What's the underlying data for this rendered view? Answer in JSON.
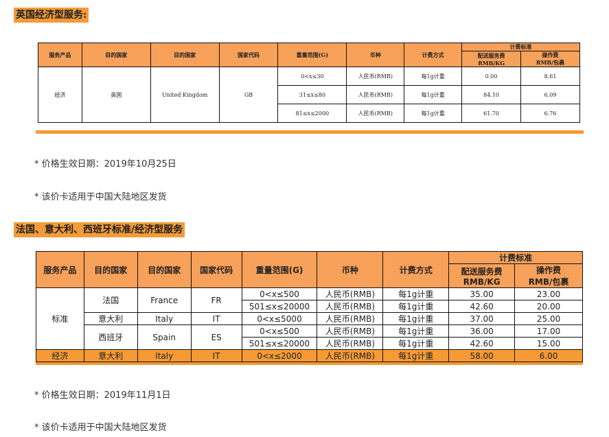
{
  "section1": {
    "heading": "英国经济型服务:",
    "headers": {
      "product": "服务产品",
      "dest_cn": "目的国家",
      "dest_en": "目的国家",
      "code": "国家代码",
      "weight": "重量范围(G)",
      "currency": "币种",
      "billing": "计费方式",
      "standard": "计费标准",
      "delivery_fee": "配送服务费",
      "delivery_unit": "RMB/KG",
      "handling_fee": "操作费",
      "handling_unit": "RMB/包裹"
    },
    "product": "经济",
    "dest_cn": "英国",
    "dest_en": "United Kingdom",
    "code": "GB",
    "rows": [
      {
        "weight": "0<x≤30",
        "currency": "人民币(RMB)",
        "billing": "每1g计重",
        "delivery": "0.00",
        "handling": "8.61"
      },
      {
        "weight": "31≤x≤80",
        "currency": "人民币(RMB)",
        "billing": "每1g计重",
        "delivery": "84.10",
        "handling": "6.09"
      },
      {
        "weight": "81≤x≤2000",
        "currency": "人民币(RMB)",
        "billing": "每1g计重",
        "delivery": "61.70",
        "handling": "6.76"
      }
    ],
    "note1": "* 价格生效日期：2019年10月25日",
    "note2": "* 该价卡适用于中国大陆地区发货"
  },
  "section2": {
    "heading": "法国、意大利、西班牙标准/经济型服务",
    "headers": {
      "product": "服务产品",
      "dest_cn": "目的国家",
      "dest_en": "目的国家",
      "code": "国家代码",
      "weight": "重量范围(G)",
      "currency": "币种",
      "billing": "计费方式",
      "standard": "计费标准",
      "delivery_fee": "配送服务费",
      "delivery_unit": "RMB/KG",
      "handling_fee": "操作费",
      "handling_unit": "RMB/包裹"
    },
    "standard_product": "标准",
    "france": {
      "cn": "法国",
      "en": "France",
      "code": "FR"
    },
    "italy": {
      "cn": "意大利",
      "en": "Italy",
      "code": "IT"
    },
    "spain": {
      "cn": "西班牙",
      "en": "Spain",
      "code": "ES"
    },
    "rows": {
      "fr1": {
        "weight": "0<x≤500",
        "currency": "人民币(RMB)",
        "billing": "每1g计重",
        "delivery": "35.00",
        "handling": "23.00"
      },
      "fr2": {
        "weight": "501≤x≤20000",
        "currency": "人民币(RMB)",
        "billing": "每1g计重",
        "delivery": "42.60",
        "handling": "20.00"
      },
      "it1": {
        "weight": "0<x≤5000",
        "currency": "人民币(RMB)",
        "billing": "每1g计重",
        "delivery": "37.00",
        "handling": "25.00"
      },
      "es1": {
        "weight": "0<x≤500",
        "currency": "人民币(RMB)",
        "billing": "每1g计重",
        "delivery": "36.00",
        "handling": "17.00"
      },
      "es2": {
        "weight": "501≤x≤20000",
        "currency": "人民币(RMB)",
        "billing": "每1g计重",
        "delivery": "42.60",
        "handling": "15.00"
      }
    },
    "economy": {
      "product": "经济",
      "cn": "意大利",
      "en": "Italy",
      "code": "IT",
      "weight": "0<x≤2000",
      "currency": "人民币(RMB)",
      "billing": "每1g计重",
      "delivery": "58.00",
      "handling": "6.00"
    },
    "note1": "* 价格生效日期：2019年11月1日",
    "note2": "* 该价卡适用于中国大陆地区发货"
  }
}
